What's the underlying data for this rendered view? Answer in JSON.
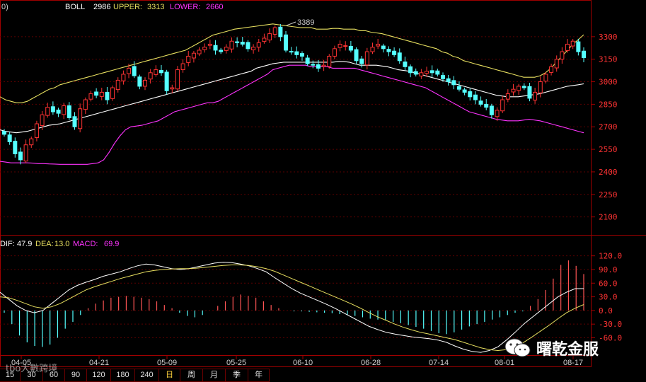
{
  "upper_panel": {
    "corner_label": "0)",
    "indicator_name": "BOLL",
    "mid_value": "2986",
    "upper_label": "UPPER:",
    "upper_value": "3313",
    "lower_label": "LOWER:",
    "lower_value": "2660",
    "peak_annotation": "3389",
    "colors": {
      "mid": "#ffffff",
      "upper": "#e8e060",
      "lower": "#ff33ff",
      "up": "#ff3333",
      "down": "#55ffff"
    }
  },
  "lower_panel": {
    "dif_label": "DIF:",
    "dif_value": "47.9",
    "dea_label": "DEA:",
    "dea_value": "13.0",
    "macd_label": "MACD:",
    "macd_value": "69.9"
  },
  "timeframe_tabs": [
    "15",
    "30",
    "60",
    "90",
    "120",
    "180",
    "240",
    "日",
    "周",
    "月",
    "季",
    "年"
  ],
  "active_tab": "日",
  "watermark": {
    "text": "曙乾金服",
    "icon": "wechat-icon",
    "small_text": "tbo大數跨境"
  },
  "chart_data": [
    {
      "type": "candlestick",
      "title": "",
      "y_ticks": [
        2100,
        2250,
        2400,
        2550,
        2700,
        2850,
        3000,
        3150,
        3300
      ],
      "ylim": [
        1990,
        3450
      ],
      "x_tick_labels": [
        "04-05",
        "04-21",
        "05-09",
        "05-25",
        "06-10",
        "06-28",
        "07-14",
        "08-01",
        "08-17"
      ],
      "grid": true,
      "close": [
        2650,
        2600,
        2520,
        2480,
        2580,
        2620,
        2720,
        2780,
        2830,
        2800,
        2790,
        2840,
        2760,
        2700,
        2820,
        2880,
        2920,
        2910,
        2930,
        2880,
        2960,
        3010,
        3050,
        3090,
        3040,
        2970,
        3010,
        3060,
        3080,
        3060,
        2940,
        2960,
        3080,
        3120,
        3170,
        3190,
        3210,
        3230,
        3250,
        3210,
        3200,
        3230,
        3270,
        3260,
        3250,
        3220,
        3230,
        3260,
        3290,
        3320,
        3360,
        3300,
        3210,
        3200,
        3180,
        3170,
        3120,
        3110,
        3090,
        3110,
        3170,
        3220,
        3250,
        3240,
        3210,
        3140,
        3120,
        3200,
        3230,
        3250,
        3220,
        3200,
        3180,
        3140,
        3100,
        3060,
        3050,
        3060,
        3070,
        3060,
        3050,
        3020,
        3000,
        2980,
        2950,
        2930,
        2900,
        2880,
        2850,
        2830,
        2780,
        2810,
        2880,
        2920,
        2950,
        2970,
        2960,
        2890,
        2930,
        3000,
        3050,
        3100,
        3150,
        3200,
        3250,
        3270,
        3200,
        3160
      ],
      "series": [
        {
          "values": [
            2900,
            2880,
            2870,
            2860,
            2860,
            2870,
            2890,
            2910,
            2930,
            2950,
            2960,
            2980,
            2990,
            3000,
            3010,
            3020,
            3030,
            3040,
            3050,
            3060,
            3070,
            3080,
            3090,
            3100,
            3110,
            3120,
            3130,
            3140,
            3150,
            3160,
            3170,
            3180,
            3190,
            3200,
            3210,
            3230,
            3250,
            3270,
            3290,
            3310,
            3320,
            3330,
            3340,
            3350,
            3355,
            3360,
            3365,
            3370,
            3375,
            3380,
            3385,
            3380,
            3375,
            3370,
            3365,
            3360,
            3360,
            3360,
            3350,
            3350,
            3350,
            3355,
            3355,
            3350,
            3350,
            3350,
            3340,
            3340,
            3330,
            3325,
            3320,
            3310,
            3300,
            3290,
            3280,
            3270,
            3260,
            3250,
            3240,
            3230,
            3220,
            3200,
            3190,
            3170,
            3160,
            3140,
            3130,
            3120,
            3110,
            3100,
            3090,
            3080,
            3070,
            3060,
            3050,
            3040,
            3030,
            3030,
            3030,
            3040,
            3060,
            3090,
            3130,
            3170,
            3210,
            3250,
            3280,
            3313
          ]
        },
        {
          "values": [
            2680,
            2670,
            2665,
            2660,
            2665,
            2670,
            2680,
            2690,
            2700,
            2710,
            2715,
            2720,
            2730,
            2740,
            2750,
            2760,
            2770,
            2780,
            2790,
            2800,
            2810,
            2820,
            2830,
            2840,
            2850,
            2860,
            2870,
            2880,
            2890,
            2900,
            2910,
            2920,
            2930,
            2940,
            2950,
            2960,
            2970,
            2980,
            2990,
            3000,
            3010,
            3020,
            3030,
            3040,
            3050,
            3060,
            3070,
            3090,
            3100,
            3110,
            3120,
            3125,
            3130,
            3130,
            3130,
            3130,
            3130,
            3130,
            3130,
            3130,
            3130,
            3130,
            3135,
            3135,
            3130,
            3120,
            3110,
            3110,
            3110,
            3110,
            3105,
            3100,
            3090,
            3080,
            3075,
            3070,
            3060,
            3050,
            3040,
            3030,
            3020,
            3010,
            3000,
            2990,
            2980,
            2970,
            2960,
            2950,
            2940,
            2930,
            2920,
            2910,
            2905,
            2900,
            2900,
            2900,
            2905,
            2910,
            2915,
            2920,
            2930,
            2940,
            2950,
            2960,
            2970,
            2975,
            2980,
            2986
          ]
        },
        {
          "values": [
            2470,
            2465,
            2460,
            2460,
            2460,
            2460,
            2458,
            2455,
            2455,
            2453,
            2452,
            2450,
            2450,
            2450,
            2450,
            2450,
            2450,
            2455,
            2460,
            2480,
            2530,
            2590,
            2640,
            2680,
            2700,
            2705,
            2710,
            2720,
            2730,
            2740,
            2760,
            2780,
            2800,
            2810,
            2820,
            2830,
            2840,
            2850,
            2860,
            2860,
            2870,
            2890,
            2910,
            2930,
            2950,
            2970,
            2990,
            3010,
            3030,
            3050,
            3080,
            3090,
            3100,
            3110,
            3110,
            3110,
            3110,
            3100,
            3100,
            3100,
            3100,
            3090,
            3090,
            3090,
            3090,
            3090,
            3080,
            3070,
            3060,
            3050,
            3040,
            3030,
            3020,
            3010,
            3000,
            2990,
            2980,
            2970,
            2960,
            2940,
            2920,
            2900,
            2880,
            2860,
            2840,
            2820,
            2800,
            2790,
            2780,
            2770,
            2760,
            2750,
            2745,
            2740,
            2740,
            2740,
            2745,
            2750,
            2745,
            2740,
            2730,
            2720,
            2710,
            2700,
            2690,
            2680,
            2670,
            2660
          ]
        }
      ]
    },
    {
      "type": "bar",
      "title": "",
      "y_ticks": [
        -60.0,
        -30.0,
        0.0,
        30.0,
        60.0,
        90.0,
        120.0
      ],
      "ylim": [
        -95,
        135
      ],
      "series": [
        {
          "values": [
            -5,
            -30,
            -55,
            -70,
            -78,
            -80,
            -75,
            -60,
            -40,
            -25,
            -10,
            5,
            15,
            22,
            28,
            30,
            32,
            30,
            28,
            25,
            20,
            12,
            5,
            -5,
            -12,
            -15,
            -10,
            0,
            10,
            20,
            30,
            35,
            32,
            28,
            20,
            12,
            5,
            0,
            -2,
            -2,
            -3,
            -4,
            -5,
            -6,
            -8,
            -10,
            -12,
            -15,
            -18,
            -20,
            -22,
            -25,
            -28,
            -32,
            -36,
            -40,
            -45,
            -50,
            -52,
            -48,
            -42,
            -35,
            -30,
            -25,
            -20,
            -15,
            -10,
            -5,
            -2,
            10,
            25,
            45,
            70,
            100,
            110,
            98,
            80
          ]
        },
        {
          "values": [
            40,
            25,
            10,
            0,
            -5,
            0,
            15,
            30,
            45,
            55,
            62,
            68,
            75,
            80,
            85,
            92,
            98,
            102,
            100,
            96,
            92,
            90,
            92,
            96,
            100,
            104,
            106,
            105,
            102,
            98,
            92,
            85,
            72,
            60,
            48,
            38,
            30,
            22,
            14,
            5,
            -5,
            -15,
            -25,
            -35,
            -42,
            -48,
            -52,
            -55,
            -58,
            -60,
            -62,
            -65,
            -70,
            -78,
            -85,
            -90,
            -92,
            -88,
            -80,
            -65,
            -48,
            -30,
            -15,
            0,
            15,
            30,
            40,
            48,
            48
          ]
        },
        {
          "values": [
            30,
            28,
            22,
            15,
            8,
            5,
            8,
            15,
            25,
            35,
            45,
            52,
            58,
            64,
            70,
            75,
            80,
            85,
            88,
            90,
            91,
            92,
            92,
            93,
            95,
            97,
            99,
            100,
            100,
            99,
            96,
            92,
            86,
            78,
            70,
            62,
            54,
            46,
            38,
            30,
            22,
            14,
            5,
            -5,
            -14,
            -22,
            -30,
            -37,
            -43,
            -48,
            -52,
            -56,
            -60,
            -64,
            -70,
            -76,
            -82,
            -86,
            -88,
            -86,
            -80,
            -70,
            -58,
            -45,
            -32,
            -18,
            -5,
            5,
            13
          ]
        }
      ]
    }
  ]
}
